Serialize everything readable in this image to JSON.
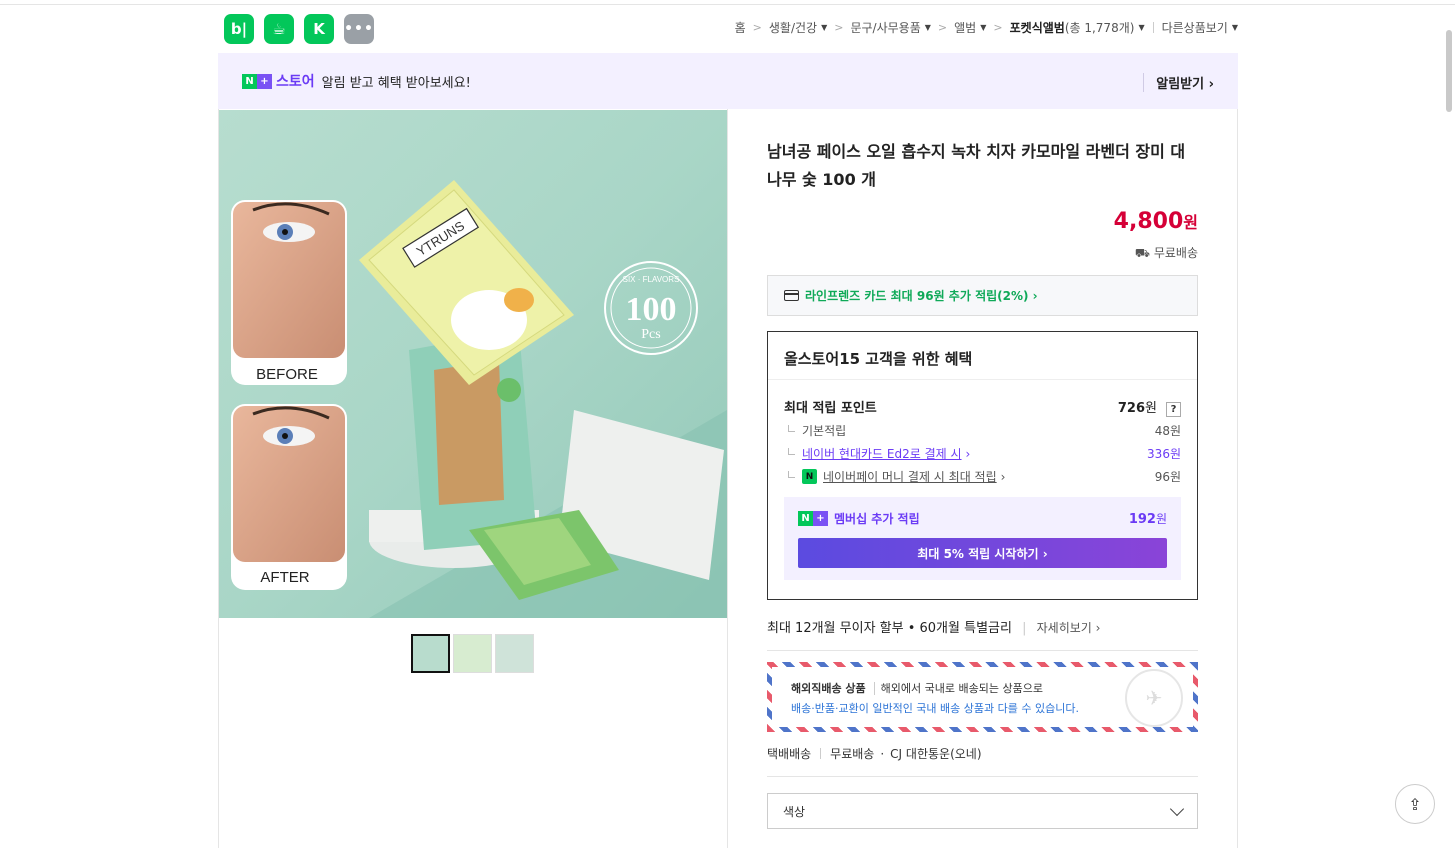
{
  "header": {
    "app_icons": [
      {
        "name": "blog-app-icon",
        "label": "b|"
      },
      {
        "name": "cafe-app-icon",
        "label": "☕"
      },
      {
        "name": "kstore-app-icon",
        "label": "K"
      },
      {
        "name": "more-apps-icon",
        "label": "•••"
      }
    ],
    "breadcrumb": {
      "home": "홈",
      "c1": "생활/건강",
      "c2": "문구/사무용품",
      "c3": "앨범",
      "c4": "포켓식앨범",
      "c4_count": "(총 1,778개)",
      "other": "다른상품보기"
    }
  },
  "notice": {
    "badge_n": "N",
    "badge_plus": "+",
    "store": "스토어",
    "message": "알림 받고 혜택 받아보세요!",
    "alarm_button": "알림받기 ›"
  },
  "product": {
    "image_text": {
      "before": "BEFORE",
      "after": "AFTER",
      "brand": "YTRUNS",
      "badge_top": "SIX · FLAVORS",
      "badge_num": "100",
      "badge_unit": "Pcs"
    },
    "title": "남녀공 페이스 오일 흡수지 녹차 치자 카모마일 라벤더 장미 대나무 숯 100 개",
    "price": "4,800",
    "price_unit": "원",
    "shipping": "무료배송",
    "card_benefit": "라인프렌즈 카드 최대 96원 추가 적립(2%) ›",
    "benefit_title": "올스토어15 고객을 위한 혜택",
    "points_label": "최대 적립 포인트",
    "points_value": "726",
    "points_unit": "원",
    "help": "?",
    "rows": [
      {
        "label": "기본적립",
        "value": "48원"
      },
      {
        "label": "네이버 현대카드 Ed2로 결제 시",
        "suffix": "›",
        "value": "336원"
      },
      {
        "label": "네이버페이 머니 결제 시 최대 적립",
        "suffix": "›",
        "value": "96원"
      }
    ],
    "npay_mark": "N",
    "membership_label": "멤버십 추가 적립",
    "membership_value": "192",
    "membership_unit": "원",
    "membership_cta": "최대 5% 적립 시작하기 ›",
    "installment": "최대 12개월 무이자 할부 • 60개월 특별금리",
    "installment_detail": "자세히보기 ›",
    "overseas_title": "해외직배송 상품",
    "overseas_desc": "해외에서 국내로 배송되는 상품으로",
    "overseas_note": "배송·반품·교환이 일반적인 국내 배송 상품과 다를 수 있습니다.",
    "delivery_type": "택배배송",
    "delivery_fee": "무료배송",
    "delivery_carrier": "CJ 대한통운(오네)",
    "option_placeholder": "색상"
  }
}
